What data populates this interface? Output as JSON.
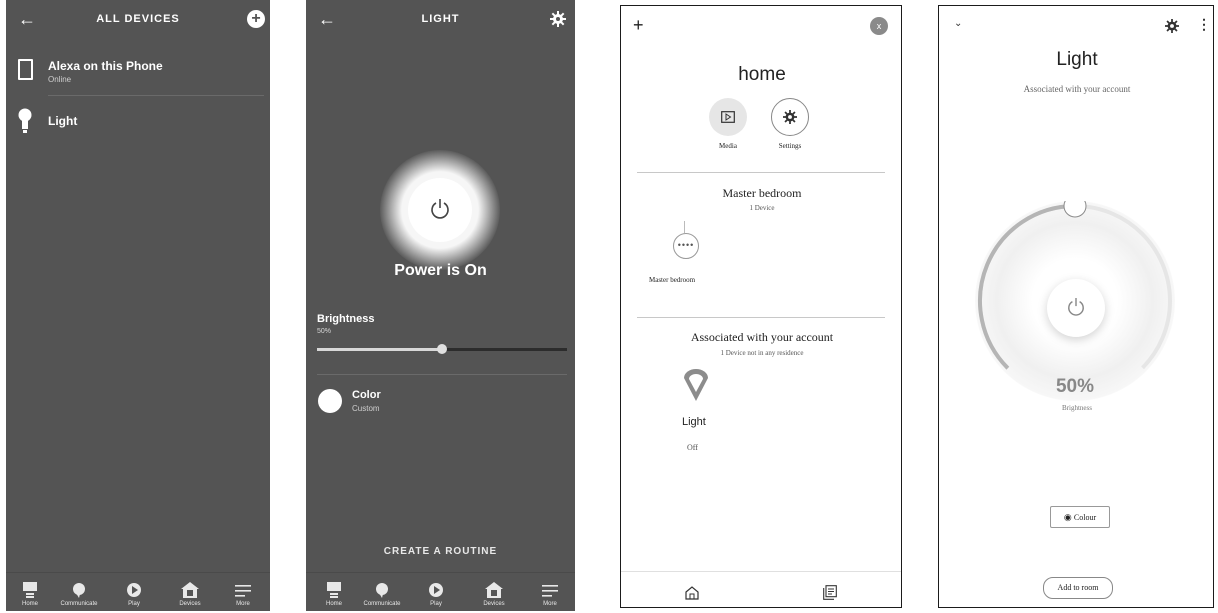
{
  "panel1": {
    "title": "ALL DEVICES",
    "devices": [
      {
        "name": "Alexa on this Phone",
        "status": "Online"
      },
      {
        "name": "Light",
        "status": ""
      }
    ],
    "nav": [
      "Home",
      "Communicate",
      "Play",
      "Devices",
      "More"
    ]
  },
  "panel2": {
    "title": "LIGHT",
    "power_status": "Power is On",
    "brightness_label": "Brightness",
    "brightness_value": "50%",
    "brightness_fraction": 0.5,
    "color_label": "Color",
    "color_value": "Custom",
    "routine_button": "CREATE A ROUTINE",
    "nav": [
      "Home",
      "Communicate",
      "Play",
      "Devices",
      "More"
    ]
  },
  "panel3": {
    "close_label": "x",
    "home_title": "home",
    "actions": [
      {
        "label": "Media"
      },
      {
        "label": "Settings"
      }
    ],
    "room_title": "Master bedroom",
    "room_count": "1 Device",
    "room_device": "Master bedroom",
    "assoc_title": "Associated with your account",
    "assoc_subtitle": "1 Device not in any residence",
    "light_name": "Light",
    "light_state": "Off"
  },
  "panel4": {
    "title": "Light",
    "subtitle": "Associated with your account",
    "brightness_value": "50%",
    "brightness_label": "Brightness",
    "brightness_fraction": 0.5,
    "colour_button": "Colour",
    "add_room_button": "Add to room"
  },
  "colors": {
    "dark_bg": "#545454",
    "accent_white": "#ffffff",
    "slider_track": "#2c2c2c"
  }
}
